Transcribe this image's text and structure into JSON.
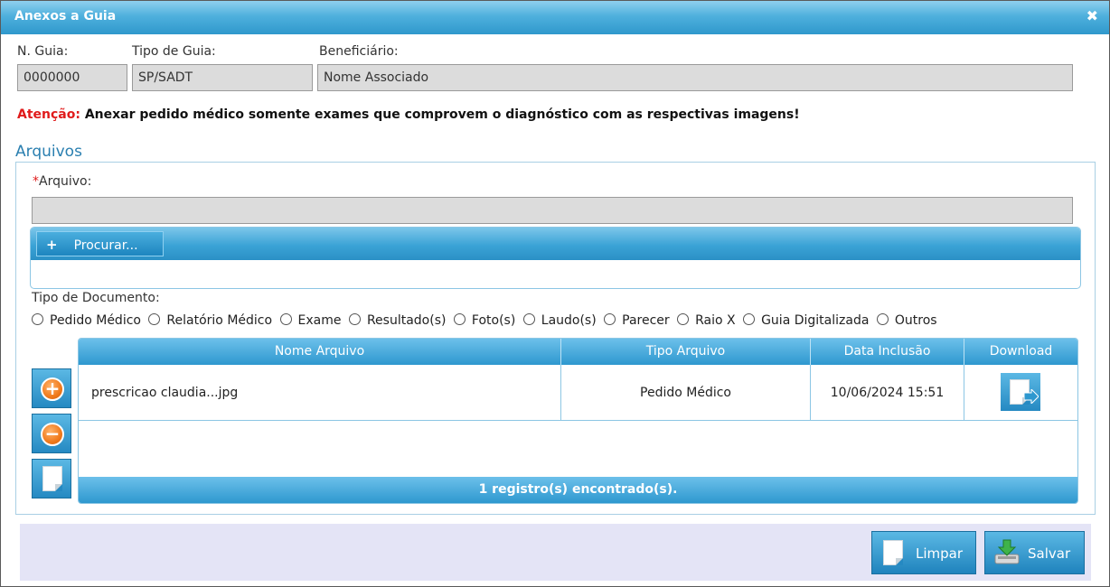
{
  "dialog": {
    "title": "Anexos a Guia",
    "close_glyph": "✖"
  },
  "header": {
    "guia_label": "N. Guia:",
    "guia_value": "0000000",
    "tipo_label": "Tipo de Guia:",
    "tipo_value": "SP/SADT",
    "beneficiario_label": "Beneficiário:",
    "beneficiario_value": "Nome Associado"
  },
  "warning": {
    "prefix": "Atenção:",
    "text": " Anexar pedido médico somente exames que comprovem o diagnóstico com as respectivas imagens!"
  },
  "arquivos": {
    "section_title": "Arquivos",
    "required_marker": "*",
    "arquivo_label": "Arquivo:",
    "browse_icon": "+",
    "browse_label": "Procurar...",
    "tipo_doc_label": "Tipo de Documento:",
    "tipo_doc_options": [
      "Pedido Médico",
      "Relatório Médico",
      "Exame",
      "Resultado(s)",
      "Foto(s)",
      "Laudo(s)",
      "Parecer",
      "Raio X",
      "Guia Digitalizada",
      "Outros"
    ]
  },
  "side_buttons": {
    "add_glyph": "+",
    "remove_glyph": "−"
  },
  "grid": {
    "columns": [
      "Nome Arquivo",
      "Tipo Arquivo",
      "Data Inclusão",
      "Download"
    ],
    "rows": [
      {
        "nome": "prescricao claudia...jpg",
        "tipo": "Pedido Médico",
        "data": "10/06/2024 15:51"
      }
    ],
    "footer": "1 registro(s) encontrado(s)."
  },
  "actions": {
    "limpar": "Limpar",
    "salvar": "Salvar"
  },
  "colors": {
    "accent": "#2f98cc",
    "warning_red": "#e01b1b",
    "section_blue": "#2a7fb0",
    "orange": "#f07a1c"
  }
}
